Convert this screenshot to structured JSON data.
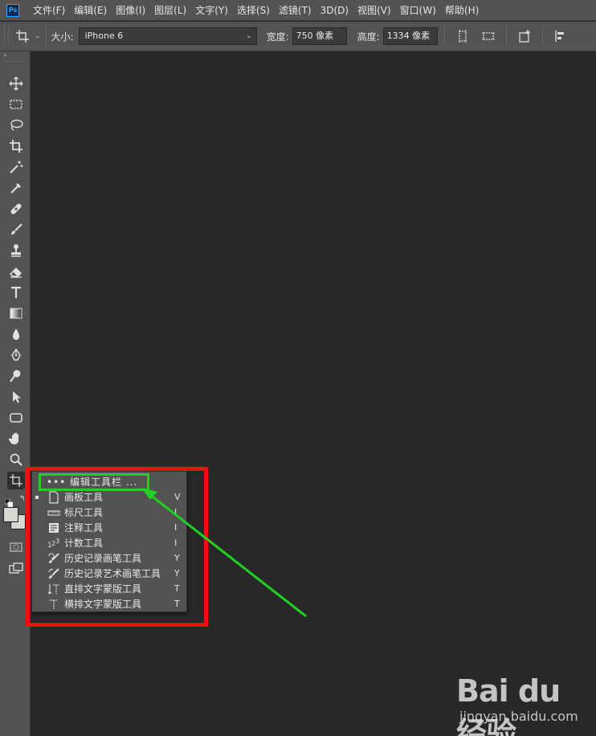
{
  "menubar": {
    "logo": "Ps",
    "items": [
      {
        "label": "文件(F)"
      },
      {
        "label": "编辑(E)"
      },
      {
        "label": "图像(I)"
      },
      {
        "label": "图层(L)"
      },
      {
        "label": "文字(Y)"
      },
      {
        "label": "选择(S)"
      },
      {
        "label": "滤镜(T)"
      },
      {
        "label": "3D(D)"
      },
      {
        "label": "视图(V)"
      },
      {
        "label": "窗口(W)"
      },
      {
        "label": "帮助(H)"
      }
    ]
  },
  "options": {
    "size_label": "大小:",
    "size_value": "iPhone 6",
    "width_label": "宽度:",
    "width_value": "750 像素",
    "height_label": "高度:",
    "height_value": "1334 像素"
  },
  "toolbar": {
    "collapse": "»"
  },
  "flyout": {
    "edit_toolbar": "••• 编辑工具栏 ...",
    "items": [
      {
        "label": "画板工具",
        "key": "V",
        "icon": "artboard-icon"
      },
      {
        "label": "标尺工具",
        "key": "I",
        "icon": "ruler-icon"
      },
      {
        "label": "注释工具",
        "key": "I",
        "icon": "note-icon"
      },
      {
        "label": "计数工具",
        "key": "I",
        "icon": "count-icon"
      },
      {
        "label": "历史记录画笔工具",
        "key": "Y",
        "icon": "history-brush-icon"
      },
      {
        "label": "历史记录艺术画笔工具",
        "key": "Y",
        "icon": "art-history-brush-icon"
      },
      {
        "label": "直排文字蒙版工具",
        "key": "T",
        "icon": "vertical-type-mask-icon"
      },
      {
        "label": "横排文字蒙版工具",
        "key": "T",
        "icon": "horizontal-type-mask-icon"
      }
    ]
  },
  "watermark": {
    "logo": "Bai du 经验",
    "sub": "jingyan.baidu.com"
  },
  "colors": {
    "annotation_red": "#ee1010",
    "annotation_green": "#22d022",
    "foreground": "#d9d8d0"
  }
}
